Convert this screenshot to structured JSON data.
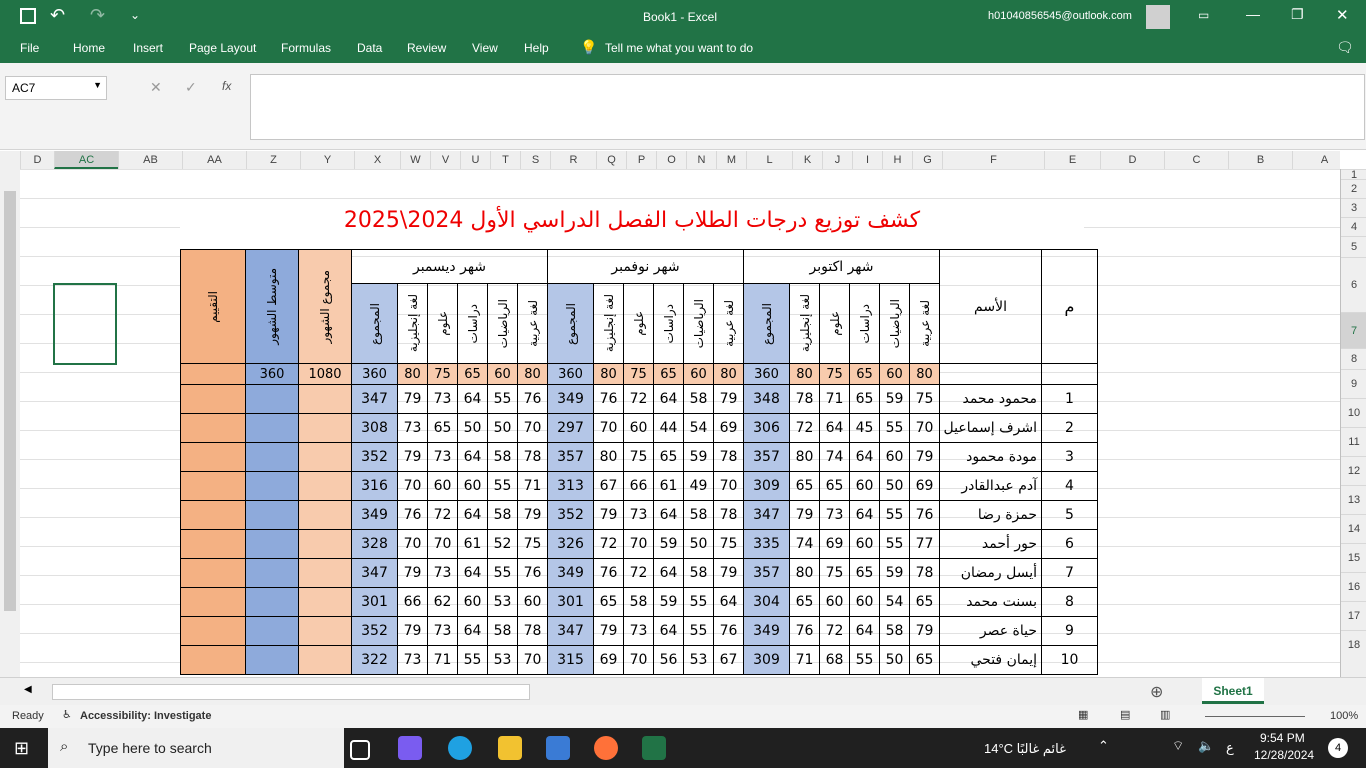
{
  "window": {
    "title": "Book1  -  Excel",
    "account": "h01040856545@outlook.com"
  },
  "ribbon_tabs": [
    "File",
    "Home",
    "Insert",
    "Page Layout",
    "Formulas",
    "Data",
    "Review",
    "View",
    "Help"
  ],
  "tell_me": "Tell me what you want to do",
  "name_box": "AC7",
  "formula_icons": [
    "✕",
    "✓",
    "fx"
  ],
  "columns": [
    "D",
    "AC",
    "AB",
    "AA",
    "Z",
    "Y",
    "X",
    "W",
    "V",
    "U",
    "T",
    "S",
    "R",
    "Q",
    "P",
    "O",
    "N",
    "M",
    "L",
    "K",
    "J",
    "I",
    "H",
    "G",
    "F",
    "E",
    "D",
    "C",
    "B",
    "A"
  ],
  "rows": [
    "1",
    "2",
    "3",
    "4",
    "5",
    "6",
    "7",
    "8",
    "9",
    "10",
    "11",
    "12",
    "13",
    "14",
    "15",
    "16",
    "17",
    "18"
  ],
  "sheet": {
    "title": "كشف توزيع درجات الطلاب الفصل الدراسي الأول 2024\\2025",
    "headers": {
      "index": "م",
      "name": "الأسم",
      "months": [
        "شهر اكتوبر",
        "شهر نوفمبر",
        "شهر ديسمبر"
      ],
      "subjects": [
        "لغة عربية",
        "الرياضيات",
        "دراسات",
        "علوم",
        "لغة إنجليزية",
        "المجموع"
      ],
      "sum_months": "مجموع الشهور",
      "avg_months": "متوسط الشهور",
      "grade": "التقييم"
    },
    "max_scores": [
      "80",
      "60",
      "65",
      "75",
      "80",
      "360"
    ],
    "max_sum": "1080",
    "max_avg": "360",
    "students": [
      {
        "n": "1",
        "name": "محمود محمد",
        "oct": [
          "75",
          "59",
          "65",
          "71",
          "78",
          "348"
        ],
        "nov": [
          "79",
          "58",
          "64",
          "72",
          "76",
          "349"
        ],
        "dec": [
          "76",
          "55",
          "64",
          "73",
          "79",
          "347"
        ]
      },
      {
        "n": "2",
        "name": "اشرف إسماعيل",
        "oct": [
          "70",
          "55",
          "45",
          "64",
          "72",
          "306"
        ],
        "nov": [
          "69",
          "54",
          "44",
          "60",
          "70",
          "297"
        ],
        "dec": [
          "70",
          "50",
          "50",
          "65",
          "73",
          "308"
        ]
      },
      {
        "n": "3",
        "name": "مودة محمود",
        "oct": [
          "79",
          "60",
          "64",
          "74",
          "80",
          "357"
        ],
        "nov": [
          "78",
          "59",
          "65",
          "75",
          "80",
          "357"
        ],
        "dec": [
          "78",
          "58",
          "64",
          "73",
          "79",
          "352"
        ]
      },
      {
        "n": "4",
        "name": "آدم عبدالقادر",
        "oct": [
          "69",
          "50",
          "60",
          "65",
          "65",
          "309"
        ],
        "nov": [
          "70",
          "49",
          "61",
          "66",
          "67",
          "313"
        ],
        "dec": [
          "71",
          "55",
          "60",
          "60",
          "70",
          "316"
        ]
      },
      {
        "n": "5",
        "name": "حمزة رضا",
        "oct": [
          "76",
          "55",
          "64",
          "73",
          "79",
          "347"
        ],
        "nov": [
          "78",
          "58",
          "64",
          "73",
          "79",
          "352"
        ],
        "dec": [
          "79",
          "58",
          "64",
          "72",
          "76",
          "349"
        ]
      },
      {
        "n": "6",
        "name": "حور أحمد",
        "oct": [
          "77",
          "55",
          "60",
          "69",
          "74",
          "335"
        ],
        "nov": [
          "75",
          "50",
          "59",
          "70",
          "72",
          "326"
        ],
        "dec": [
          "75",
          "52",
          "61",
          "70",
          "70",
          "328"
        ]
      },
      {
        "n": "7",
        "name": "أيسل رمضان",
        "oct": [
          "78",
          "59",
          "65",
          "75",
          "80",
          "357"
        ],
        "nov": [
          "79",
          "58",
          "64",
          "72",
          "76",
          "349"
        ],
        "dec": [
          "76",
          "55",
          "64",
          "73",
          "79",
          "347"
        ]
      },
      {
        "n": "8",
        "name": "بسنت محمد",
        "oct": [
          "65",
          "54",
          "60",
          "60",
          "65",
          "304"
        ],
        "nov": [
          "64",
          "55",
          "59",
          "58",
          "65",
          "301"
        ],
        "dec": [
          "60",
          "53",
          "60",
          "62",
          "66",
          "301"
        ]
      },
      {
        "n": "9",
        "name": "حياة عصر",
        "oct": [
          "79",
          "58",
          "64",
          "72",
          "76",
          "349"
        ],
        "nov": [
          "76",
          "55",
          "64",
          "73",
          "79",
          "347"
        ],
        "dec": [
          "78",
          "58",
          "64",
          "73",
          "79",
          "352"
        ]
      },
      {
        "n": "10",
        "name": "إيمان فتحي",
        "oct": [
          "65",
          "50",
          "55",
          "68",
          "71",
          "309"
        ],
        "nov": [
          "67",
          "53",
          "56",
          "70",
          "69",
          "315"
        ],
        "dec": [
          "70",
          "53",
          "55",
          "71",
          "73",
          "322"
        ]
      }
    ]
  },
  "sheet_tab": "Sheet1",
  "status": {
    "ready": "Ready",
    "accessibility": "Accessibility: Investigate",
    "zoom": "100%"
  },
  "taskbar": {
    "search": "Type here to search",
    "weather": "14°C  غائم غالبًا",
    "lang": "ع",
    "time": "9:54 PM",
    "date": "12/28/2024",
    "notif": "4"
  },
  "colors": {
    "excel_green": "#217346",
    "title_red": "#e00000",
    "blue": "#b4c6e7",
    "peach": "#f8cbad"
  }
}
